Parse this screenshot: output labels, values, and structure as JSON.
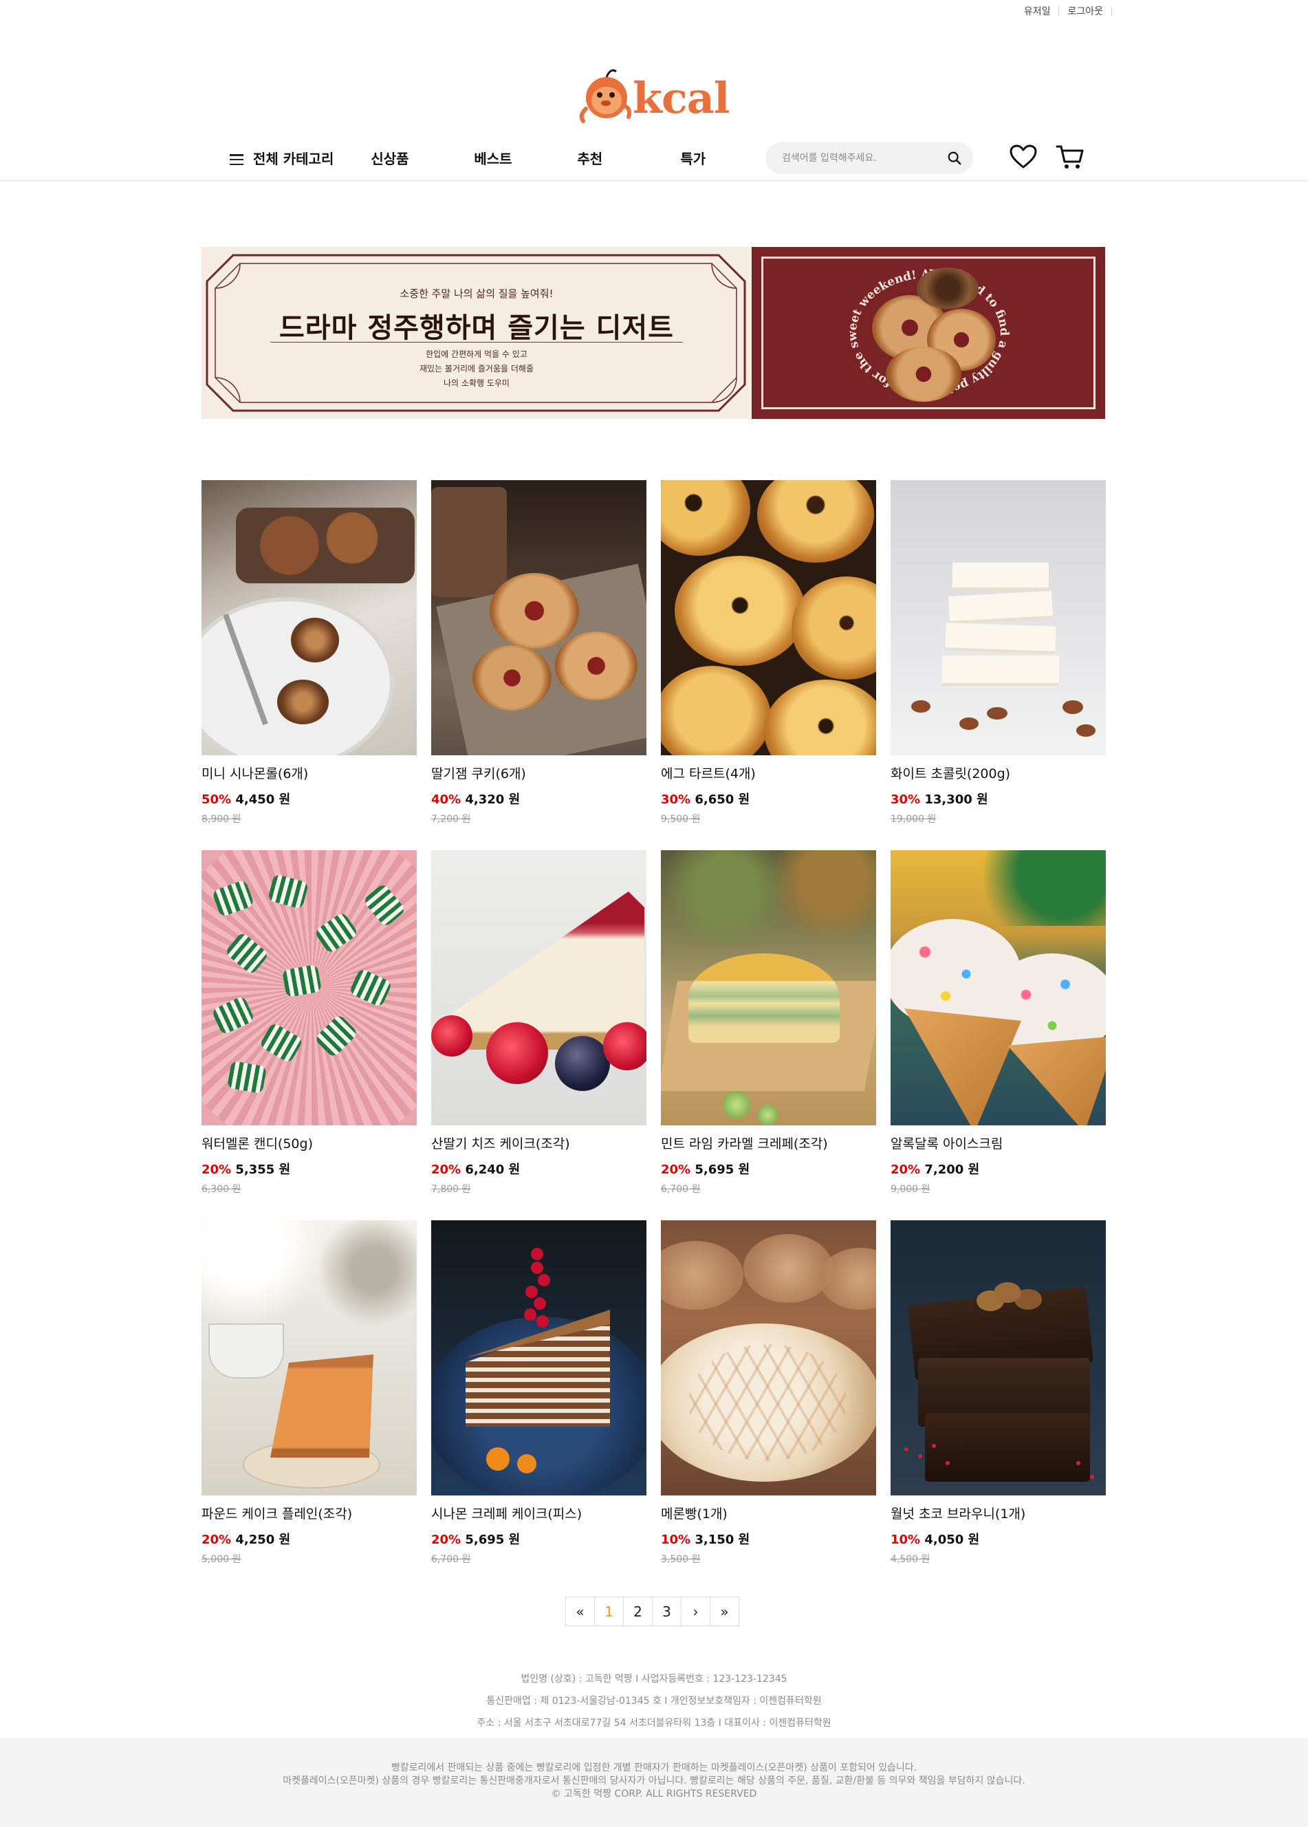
{
  "util": {
    "user": "유저일",
    "logout": "로그아웃"
  },
  "logo": {
    "text": "kcal"
  },
  "nav": {
    "all_categories": "전체 카테고리",
    "items": [
      "신상품",
      "베스트",
      "추천",
      "특가"
    ],
    "search_placeholder": "검색어를 입력해주세요."
  },
  "banner": {
    "small_text": "소중한 주말 나의 삶의 질을 높여줘!",
    "title": "드라마 정주행하며 즐기는 디저트",
    "sub_lines": [
      "한입에 간편하게 먹을 수 있고",
      "재밌는 볼거리에 즐거움을 더해줄",
      "나의 소확행 도우미"
    ],
    "circle_text": "I wanted to find a guilty pet dessert for the sweet weekend! All the desserts"
  },
  "products": [
    {
      "name": "미니 시나몬롤(6개)",
      "discount": "50%",
      "price": "4,450 원",
      "original": "8,900 원"
    },
    {
      "name": "딸기잼 쿠키(6개)",
      "discount": "40%",
      "price": "4,320 원",
      "original": "7,200 원"
    },
    {
      "name": "에그 타르트(4개)",
      "discount": "30%",
      "price": "6,650 원",
      "original": "9,500 원"
    },
    {
      "name": "화이트 초콜릿(200g)",
      "discount": "30%",
      "price": "13,300 원",
      "original": "19,000 원"
    },
    {
      "name": "워터멜론 캔디(50g)",
      "discount": "20%",
      "price": "5,355 원",
      "original": "6,300 원"
    },
    {
      "name": "산딸기 치즈 케이크(조각)",
      "discount": "20%",
      "price": "6,240 원",
      "original": "7,800 원"
    },
    {
      "name": "민트 라임 카라멜 크레페(조각)",
      "discount": "20%",
      "price": "5,695 원",
      "original": "6,700 원"
    },
    {
      "name": "알록달록 아이스크림",
      "discount": "20%",
      "price": "7,200 원",
      "original": "9,000 원"
    },
    {
      "name": "파운드 케이크 플레인(조각)",
      "discount": "20%",
      "price": "4,250 원",
      "original": "5,000 원"
    },
    {
      "name": "시나몬 크레페 케이크(피스)",
      "discount": "20%",
      "price": "5,695 원",
      "original": "6,700 원"
    },
    {
      "name": "메론빵(1개)",
      "discount": "10%",
      "price": "3,150 원",
      "original": "3,500 원"
    },
    {
      "name": "월넛 초코 브라우니(1개)",
      "discount": "10%",
      "price": "4,050 원",
      "original": "4,500 원"
    }
  ],
  "pagination": {
    "first": "«",
    "pages": [
      "1",
      "2",
      "3"
    ],
    "next": "›",
    "last": "»",
    "current": "1"
  },
  "footer": {
    "info_lines": [
      "법인명 (상호) : 고독한 먹짱 I 사업자등록번호 : 123-123-12345",
      "통신판매업 : 제 0123-서울강남-01345 호 I 개인정보보호책임자 : 이젠컴퓨터학원",
      "주소 : 서울 서초구 서초대로77길 54 서초더블유타워 13층 I 대표이사 : 이젠컴퓨터학원"
    ],
    "notice_lines": [
      "빵칼로리에서 판매되는 상품 중에는 빵칼로리에 입점한 개별 판매자가 판매하는 마켓플레이스(오픈마켓) 상품이 포함되어 있습니다.",
      "마켓플레이스(오픈마켓) 상품의 경우 빵칼로리는 통신판매중개자로서 통신판매의 당사자가 아닙니다. 빵칼로리는 해당 상품의 주문, 품질, 교환/환불 등 의무와 책임을 부담하지 않습니다.",
      "© 고독한 먹짱 CORP. ALL RIGHTS RESERVED"
    ]
  },
  "colors": {
    "accent": "#e8703a",
    "discount": "#e10000",
    "banner_dark": "#7a2327",
    "banner_light": "#f6ede2",
    "page_active": "#e8a10a"
  }
}
